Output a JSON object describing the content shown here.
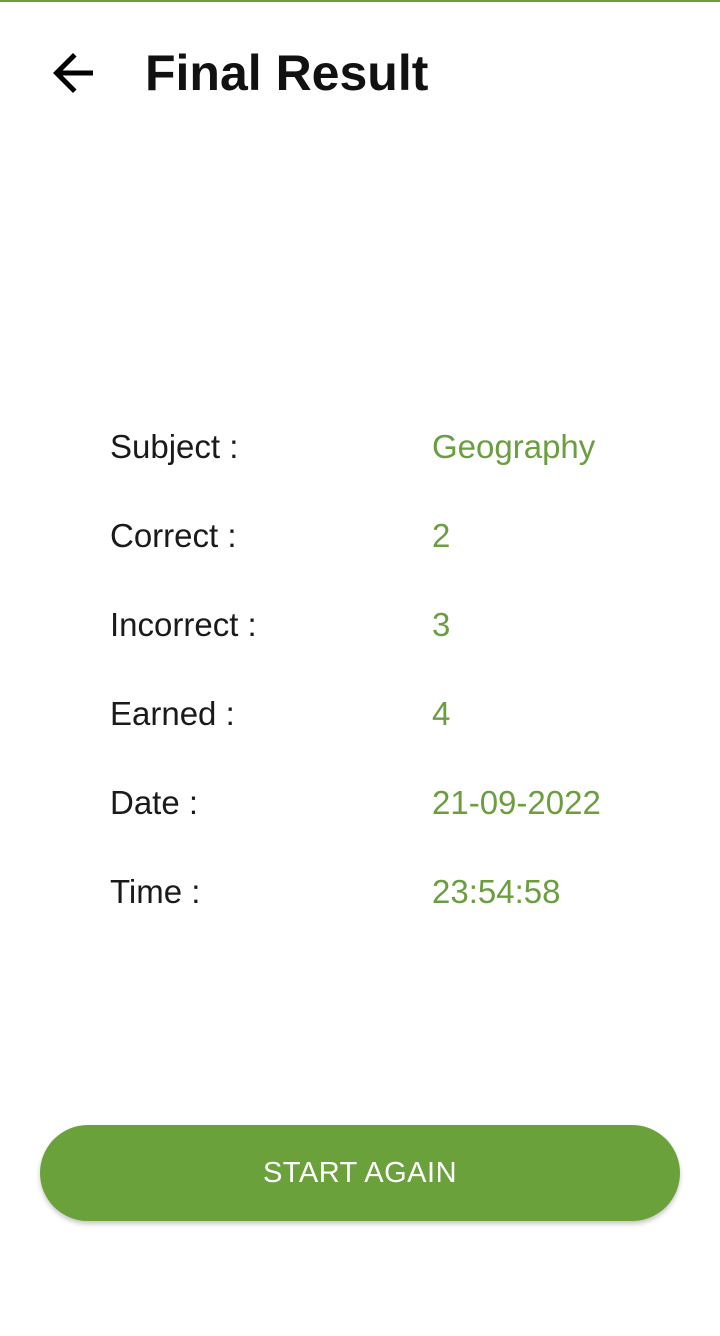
{
  "theme": {
    "accent": "#6aa13a",
    "accent_text": "#6a9e3f"
  },
  "header": {
    "back_icon": "arrow-left-icon",
    "title": "Final Result"
  },
  "results": [
    {
      "label": "Subject :",
      "value": "Geography"
    },
    {
      "label": "Correct :",
      "value": "2"
    },
    {
      "label": "Incorrect :",
      "value": "3"
    },
    {
      "label": "Earned :",
      "value": "4"
    },
    {
      "label": "Date :",
      "value": "21-09-2022"
    },
    {
      "label": "Time :",
      "value": "23:54:58"
    }
  ],
  "actions": {
    "start_again_label": "START AGAIN"
  }
}
